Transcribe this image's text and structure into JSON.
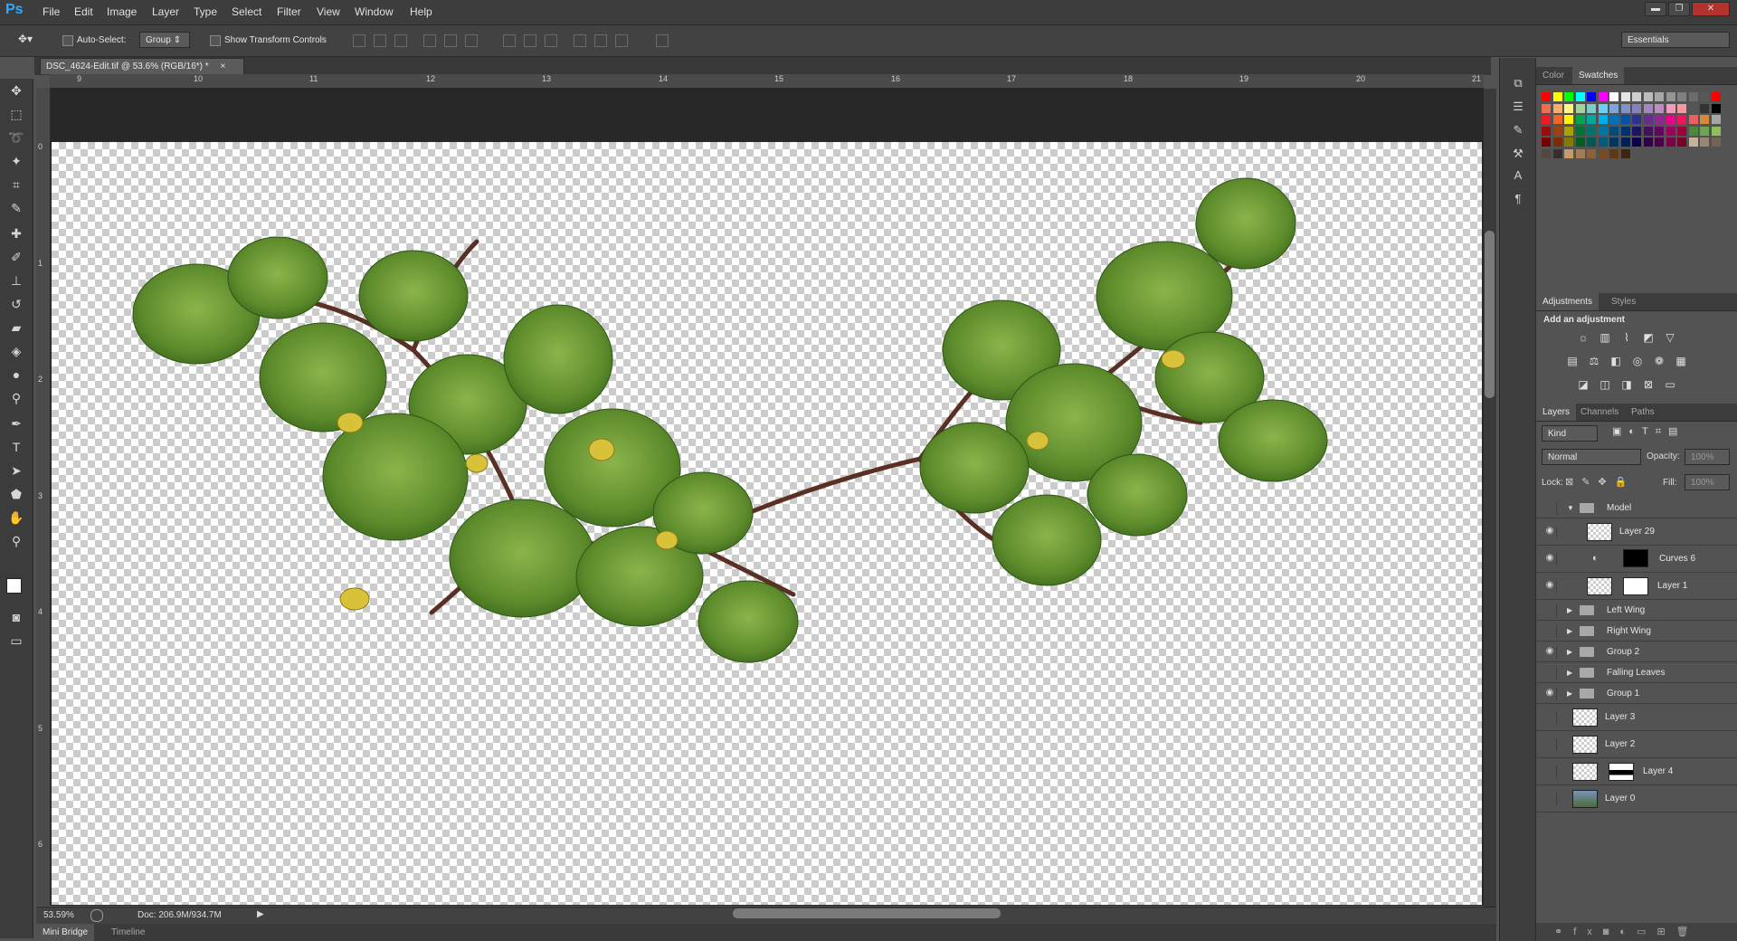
{
  "app": {
    "logo": "Ps"
  },
  "menu": [
    "File",
    "Edit",
    "Image",
    "Layer",
    "Type",
    "Select",
    "Filter",
    "View",
    "Window",
    "Help"
  ],
  "window_controls": {
    "minimize": "▬",
    "restore": "❐",
    "close": "✕"
  },
  "options_bar": {
    "auto_select_label": "Auto-Select:",
    "auto_select_value": "Group",
    "show_transform_label": "Show Transform Controls",
    "workspace": "Essentials"
  },
  "document": {
    "tab_title": "DSC_4624-Edit.tif @ 53.6% (RGB/16*) *",
    "close": "×",
    "zoom": "53.59%",
    "doc_info": "Doc: 206.9M/934.7M"
  },
  "ruler": {
    "top": [
      "9",
      "10",
      "11",
      "12",
      "13",
      "14",
      "15",
      "16",
      "17",
      "18",
      "19",
      "20",
      "21"
    ],
    "left": [
      "0",
      "1",
      "2",
      "3",
      "4",
      "5",
      "6"
    ]
  },
  "bottom_tabs": [
    "Mini Bridge",
    "Timeline"
  ],
  "color_panel": {
    "tabs": [
      "Color",
      "Swatches"
    ],
    "active": "Swatches"
  },
  "adjustments_panel": {
    "tabs": [
      "Adjustments",
      "Styles"
    ],
    "heading": "Add an adjustment"
  },
  "layers_panel": {
    "tabs": [
      "Layers",
      "Channels",
      "Paths"
    ],
    "kind_filter": "Kind",
    "blend_mode": "Normal",
    "opacity_label": "Opacity:",
    "opacity_value": "100%",
    "lock_label": "Lock:",
    "fill_label": "Fill:",
    "fill_value": "100%",
    "layers": [
      {
        "name": "Model",
        "type": "group",
        "expanded": true,
        "visible": false
      },
      {
        "name": "Layer 29",
        "type": "layer",
        "visible": true
      },
      {
        "name": "Curves 6",
        "type": "adjustment",
        "visible": true
      },
      {
        "name": "Layer 1",
        "type": "layer-mask",
        "visible": true
      },
      {
        "name": "Left Wing",
        "type": "group",
        "visible": false
      },
      {
        "name": "Right Wing",
        "type": "group",
        "visible": false
      },
      {
        "name": "Group 2",
        "type": "group",
        "visible": true
      },
      {
        "name": "Falling Leaves",
        "type": "group",
        "visible": false
      },
      {
        "name": "Group 1",
        "type": "group",
        "visible": true
      },
      {
        "name": "Layer 3",
        "type": "layer",
        "visible": false
      },
      {
        "name": "Layer 2",
        "type": "layer",
        "visible": false
      },
      {
        "name": "Layer 4",
        "type": "layer-mask",
        "visible": false
      },
      {
        "name": "Layer 0",
        "type": "photo",
        "visible": false
      }
    ]
  },
  "colors": {
    "accent": "#31a8ff",
    "leaf_dark": "#3f6a1e",
    "leaf_light": "#7fa83a",
    "branch": "#5a3a2a"
  }
}
